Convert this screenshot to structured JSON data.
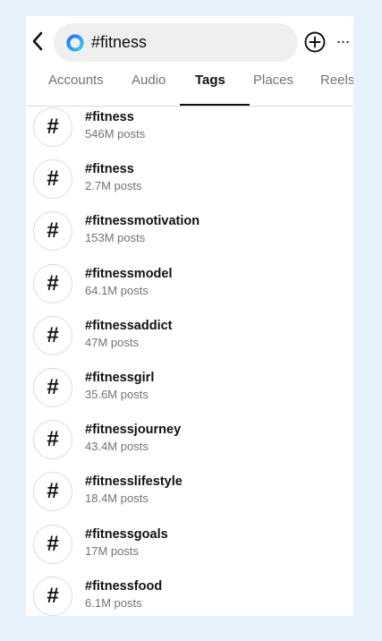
{
  "search": {
    "query": "#fitness"
  },
  "icons": {
    "back": "chevron-left-icon",
    "search_ring": "meta-ai-ring-icon",
    "add": "plus-circle-icon",
    "more": "more-horizontal-icon",
    "hashtag": "#"
  },
  "more_label": "···",
  "tabs": [
    {
      "label": "Accounts"
    },
    {
      "label": "Audio"
    },
    {
      "label": "Tags",
      "active": true
    },
    {
      "label": "Places"
    },
    {
      "label": "Reels"
    }
  ],
  "results": [
    {
      "name": "#fitness",
      "count": "546M posts"
    },
    {
      "name": "#fitness",
      "count": "2.7M posts"
    },
    {
      "name": "#fitnessmotivation",
      "count": "153M posts"
    },
    {
      "name": "#fitnessmodel",
      "count": "64.1M posts"
    },
    {
      "name": "#fitnessaddict",
      "count": "47M posts"
    },
    {
      "name": "#fitnessgirl",
      "count": "35.6M posts"
    },
    {
      "name": "#fitnessjourney",
      "count": "43.4M posts"
    },
    {
      "name": "#fitnesslifestyle",
      "count": "18.4M posts"
    },
    {
      "name": "#fitnessgoals",
      "count": "17M posts"
    },
    {
      "name": "#fitnessfood",
      "count": "6.1M posts"
    }
  ],
  "colors": {
    "page_background": "#e8f2fc",
    "secondary_text": "#737373",
    "search_field": "#efefef"
  }
}
